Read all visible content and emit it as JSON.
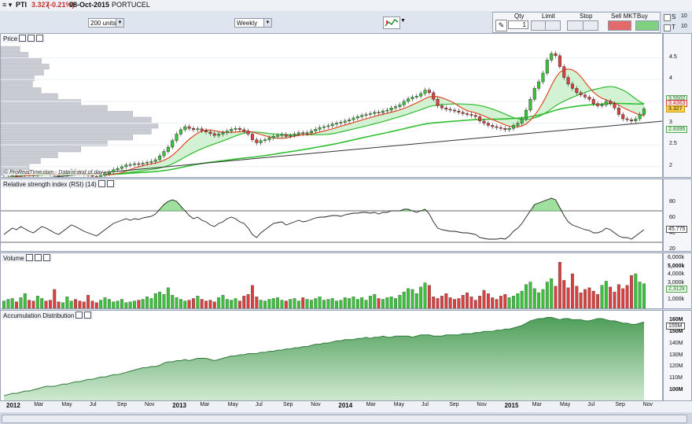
{
  "header": {
    "ticker": "PTI",
    "price": "3.327",
    "change": "(-0.21%)",
    "date": "08-Oct-2015",
    "name": "PORTUCEL"
  },
  "toolbar": {
    "units": "200 units",
    "period": "Weekly"
  },
  "order": {
    "qty_label": "Qty",
    "qty": "1",
    "limit": "Limit",
    "stop": "Stop",
    "sell": "Sell MKT",
    "buy": "Buy MKT",
    "s_label": "S",
    "t_label": "T",
    "s_val": "10",
    "t_val": "10"
  },
  "panels": {
    "price": "Price",
    "rsi": "Relative strength index (RSI) (14)",
    "volume": "Volume",
    "accum": "Accumulation Distribution",
    "footnote": "© ProRealTime.com - Data is end of day"
  },
  "colors": {
    "up": "#3cc13c",
    "down": "#d94040",
    "accent": "#2e8b3e"
  },
  "chart_data": [
    {
      "type": "candlestick",
      "title": "Price",
      "ylim": [
        1.8,
        4.8
      ],
      "yticks": [
        "4.5",
        "4",
        "3.5",
        "3",
        "2.5",
        "2"
      ],
      "tags": [
        {
          "value": "3.5502"
        },
        {
          "value": "3.4363"
        },
        {
          "value": "3.327"
        },
        {
          "value": "2.8395"
        }
      ],
      "close": [
        1.75,
        1.76,
        1.8,
        1.78,
        1.82,
        1.85,
        1.82,
        1.8,
        1.84,
        1.88,
        1.85,
        1.83,
        1.8,
        1.78,
        1.82,
        1.86,
        1.9,
        1.88,
        1.85,
        1.83,
        1.8,
        1.78,
        1.76,
        1.8,
        1.84,
        1.88,
        1.93,
        1.96,
        2.0,
        2.04,
        2.05,
        2.07,
        2.06,
        2.08,
        2.1,
        2.12,
        2.16,
        2.25,
        2.35,
        2.45,
        2.6,
        2.75,
        2.85,
        2.92,
        2.88,
        2.85,
        2.87,
        2.83,
        2.8,
        2.76,
        2.72,
        2.75,
        2.78,
        2.82,
        2.86,
        2.88,
        2.85,
        2.82,
        2.75,
        2.62,
        2.55,
        2.6,
        2.62,
        2.66,
        2.7,
        2.72,
        2.74,
        2.7,
        2.72,
        2.75,
        2.78,
        2.76,
        2.78,
        2.82,
        2.86,
        2.9,
        2.92,
        2.94,
        2.98,
        3.0,
        3.02,
        3.05,
        3.08,
        3.12,
        3.15,
        3.18,
        3.2,
        3.22,
        3.25,
        3.24,
        3.28,
        3.3,
        3.35,
        3.38,
        3.42,
        3.5,
        3.56,
        3.6,
        3.62,
        3.68,
        3.76,
        3.7,
        3.55,
        3.4,
        3.35,
        3.32,
        3.3,
        3.28,
        3.25,
        3.22,
        3.2,
        3.18,
        3.15,
        3.05,
        3.0,
        2.95,
        2.92,
        2.9,
        2.88,
        2.85,
        2.88,
        2.95,
        3.0,
        3.1,
        3.3,
        3.55,
        3.8,
        3.95,
        4.15,
        4.45,
        4.6,
        4.55,
        4.3,
        4.05,
        3.9,
        3.8,
        3.7,
        3.65,
        3.6,
        3.55,
        3.45,
        3.4,
        3.42,
        3.5,
        3.45,
        3.35,
        3.2,
        3.1,
        3.08,
        3.05,
        3.1,
        3.2,
        3.33
      ],
      "x_labels": [
        "2012",
        "Mar",
        "May",
        "Jul",
        "Sep",
        "Nov",
        "2013",
        "Mar",
        "May",
        "Jul",
        "Sep",
        "Nov",
        "2014",
        "Mar",
        "May",
        "Jul",
        "Sep",
        "Nov",
        "2015",
        "Mar",
        "May",
        "Jul",
        "Sep",
        "Nov"
      ]
    },
    {
      "type": "line",
      "title": "Relative strength index (RSI) (14)",
      "ylim": [
        20,
        100
      ],
      "yticks": [
        "80",
        "60",
        "40",
        "20"
      ],
      "levels": [
        70,
        30
      ],
      "last": "45.775",
      "values": [
        40,
        44,
        48,
        46,
        50,
        47,
        44,
        42,
        46,
        50,
        48,
        45,
        42,
        40,
        44,
        48,
        52,
        50,
        47,
        44,
        42,
        40,
        38,
        42,
        46,
        50,
        54,
        56,
        58,
        60,
        58,
        60,
        59,
        61,
        62,
        63,
        66,
        72,
        78,
        82,
        84,
        82,
        76,
        70,
        64,
        60,
        62,
        58,
        56,
        52,
        50,
        54,
        56,
        60,
        62,
        60,
        56,
        54,
        48,
        40,
        36,
        42,
        46,
        50,
        54,
        55,
        56,
        52,
        54,
        56,
        58,
        56,
        57,
        59,
        61,
        62,
        62,
        63,
        64,
        64,
        63,
        65,
        66,
        67,
        67,
        68,
        68,
        67,
        68,
        66,
        68,
        68,
        70,
        70,
        70,
        72,
        72,
        70,
        68,
        70,
        72,
        66,
        56,
        48,
        46,
        45,
        44,
        44,
        43,
        42,
        42,
        41,
        40,
        36,
        35,
        34,
        34,
        34,
        35,
        34,
        38,
        44,
        48,
        54,
        62,
        70,
        78,
        80,
        82,
        84,
        86,
        84,
        74,
        64,
        56,
        52,
        50,
        48,
        46,
        45,
        42,
        42,
        44,
        48,
        46,
        42,
        38,
        36,
        36,
        34,
        38,
        42,
        46
      ]
    },
    {
      "type": "bar",
      "title": "Volume",
      "ylim": [
        0,
        6300000
      ],
      "yticks": [
        "6,000k",
        "5,000k",
        "4,000k",
        "3,000k",
        "2,000k",
        "1,000k"
      ],
      "last": "2,312k",
      "values": [
        900,
        1100,
        1200,
        800,
        1300,
        1800,
        1000,
        900,
        1500,
        1200,
        900,
        1000,
        2300,
        800,
        700,
        1400,
        900,
        1100,
        900,
        800,
        1600,
        900,
        700,
        1000,
        1300,
        1100,
        800,
        900,
        1100,
        700,
        800,
        900,
        1000,
        1100,
        1400,
        1200,
        1800,
        2000,
        1700,
        2500,
        1600,
        1300,
        1100,
        900,
        1000,
        1200,
        1500,
        1100,
        900,
        1000,
        800,
        1300,
        1600,
        1100,
        1000,
        1200,
        900,
        1500,
        1700,
        2800,
        1400,
        1000,
        900,
        1100,
        1200,
        1300,
        1000,
        900,
        1100,
        1200,
        900,
        1300,
        1100,
        1000,
        1200,
        1400,
        1000,
        1100,
        1200,
        900,
        1000,
        1300,
        1200,
        1400,
        1100,
        1300,
        1000,
        1500,
        1700,
        1200,
        1100,
        1300,
        1400,
        1200,
        1600,
        2000,
        2400,
        2300,
        1800,
        2600,
        3100,
        2800,
        1400,
        1200,
        1500,
        1800,
        1300,
        1100,
        1200,
        1600,
        1900,
        1400,
        1000,
        1500,
        2200,
        1800,
        1300,
        1100,
        1500,
        1700,
        1300,
        1500,
        1800,
        2100,
        2900,
        3200,
        2400,
        1900,
        2300,
        3200,
        3600,
        2700,
        5600,
        3400,
        2500,
        4200,
        2700,
        1900,
        2300,
        2500,
        2100,
        1700,
        2800,
        3300,
        2600,
        2000,
        2900,
        2400,
        2800,
        4000,
        4200,
        3200,
        3000
      ],
      "colors_up_down": "alternating by price change"
    },
    {
      "type": "area",
      "title": "Accumulation Distribution",
      "ylim": [
        92000000,
        166000000
      ],
      "yticks": [
        "160M",
        "150M",
        "140M",
        "130M",
        "120M",
        "110M",
        "100M"
      ],
      "last": "155M",
      "values": [
        96,
        97,
        98,
        98,
        99,
        100,
        100,
        101,
        102,
        103,
        104,
        104,
        104,
        105,
        106,
        106,
        107,
        108,
        108,
        109,
        110,
        110,
        111,
        112,
        112,
        113,
        114,
        114,
        115,
        116,
        117,
        118,
        119,
        120,
        120,
        121,
        121,
        122,
        124,
        125,
        125,
        126,
        126,
        127,
        126,
        127,
        128,
        128,
        128,
        127,
        126,
        127,
        128,
        129,
        130,
        130,
        131,
        131,
        132,
        132,
        132,
        133,
        133,
        134,
        134,
        135,
        135,
        136,
        136,
        137,
        137,
        138,
        138,
        139,
        140,
        140,
        141,
        141,
        142,
        143,
        143,
        144,
        144,
        144,
        145,
        145,
        146,
        145,
        146,
        146,
        147,
        146,
        146,
        147,
        147,
        147,
        147,
        146,
        147,
        148,
        148,
        148,
        147,
        147,
        147,
        148,
        148,
        148,
        148,
        149,
        149,
        149,
        150,
        150,
        151,
        151,
        151,
        152,
        152,
        153,
        153,
        154,
        155,
        156,
        158,
        160,
        161,
        162,
        162,
        163,
        163,
        162,
        161,
        162,
        162,
        161,
        161,
        161,
        160,
        160,
        161,
        162,
        162,
        161,
        160,
        160,
        159,
        158,
        158,
        157,
        157,
        158,
        159
      ]
    }
  ]
}
